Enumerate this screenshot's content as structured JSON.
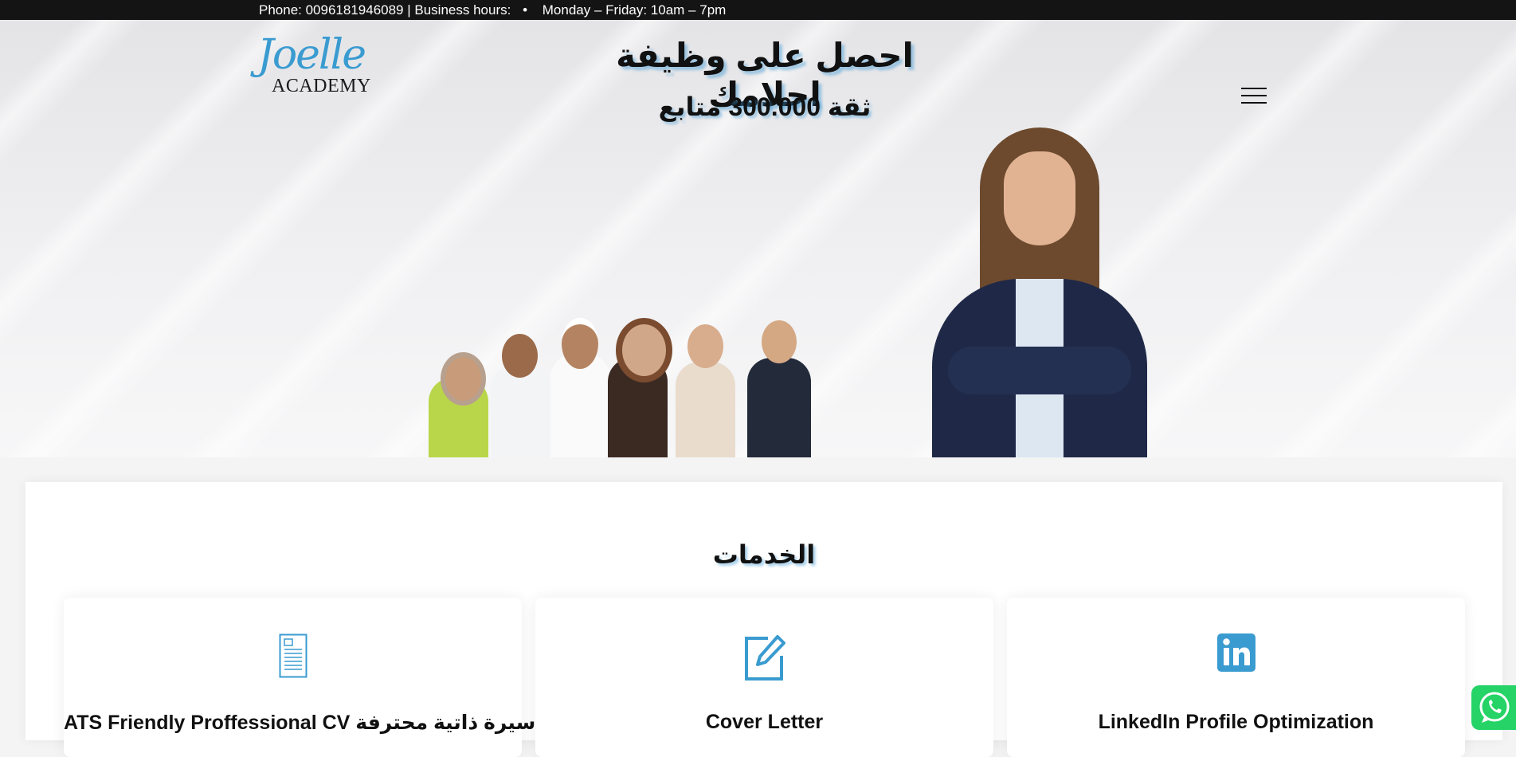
{
  "topbar": {
    "phone_text": "Phone: 0096181946089 | Business hours:",
    "bullet": "•",
    "hours_text": "Monday – Friday: 10am – 7pm"
  },
  "header": {
    "logo_script": "Joelle",
    "logo_word": "ACADEMY",
    "menu_icon": "hamburger-menu-icon"
  },
  "hero": {
    "title": "احصل على وظيفة احلامك",
    "subtitle": "ثقة 300.000 متابع"
  },
  "services": {
    "title": "الخدمات",
    "cards": [
      {
        "icon": "document-icon",
        "title": "ATS Friendly Proffessional CV سيرة ذاتية محترفة"
      },
      {
        "icon": "edit-pencil-icon",
        "title": "Cover Letter"
      },
      {
        "icon": "linkedin-icon",
        "title": "LinkedIn Profile Optimization"
      }
    ]
  },
  "floating": {
    "whatsapp_icon": "whatsapp-icon"
  },
  "colors": {
    "accent_blue": "#3a9bd0",
    "topbar_bg": "#141414",
    "whatsapp_green": "#25d366"
  }
}
